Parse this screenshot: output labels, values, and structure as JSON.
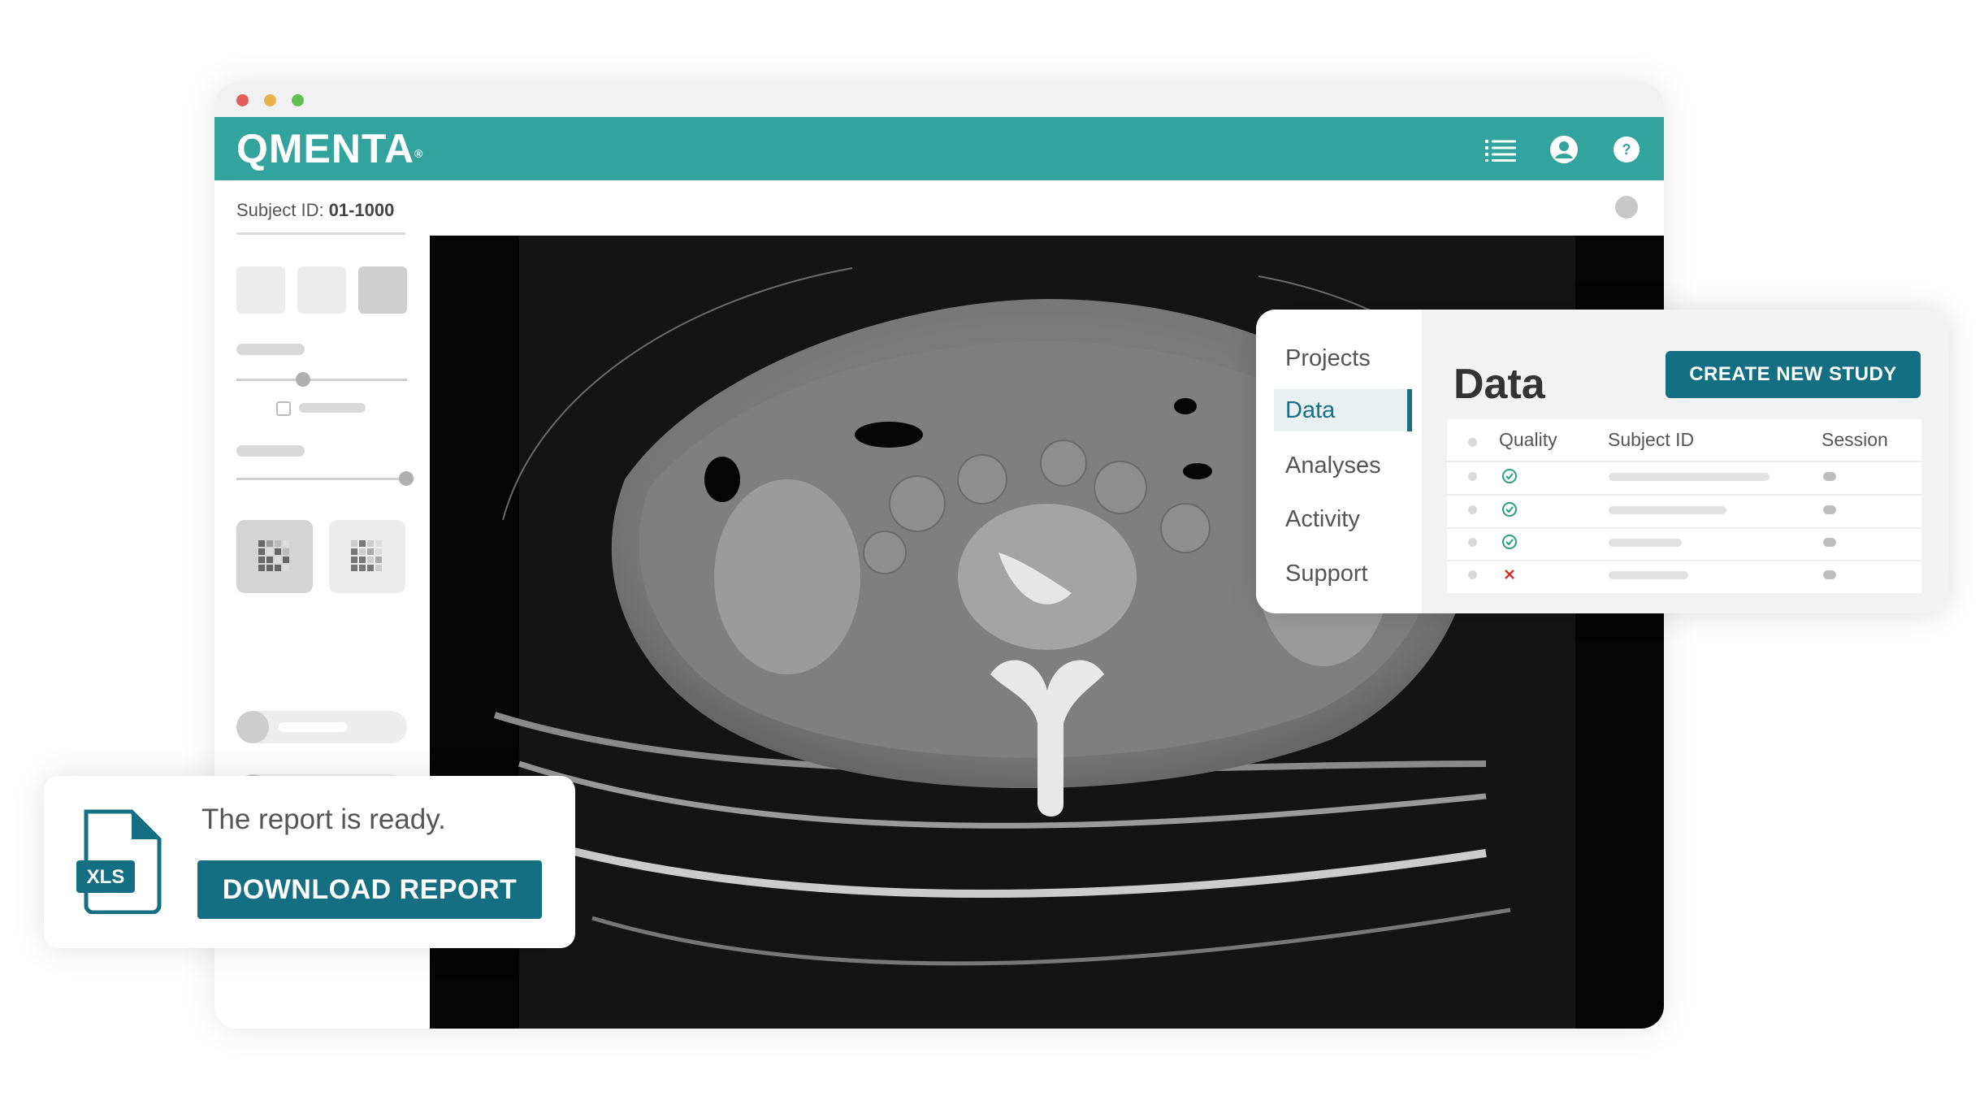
{
  "app": {
    "brand": "QMENTA",
    "brand_mark": "®",
    "accent_color": "#33a39e",
    "button_color": "#146f82",
    "icons": [
      "list-icon",
      "user-account-icon",
      "help-icon"
    ]
  },
  "subject": {
    "label": "Subject ID:",
    "value": "01-1000"
  },
  "data_panel": {
    "nav": [
      {
        "label": "Projects"
      },
      {
        "label": "Data"
      },
      {
        "label": "Analyses"
      },
      {
        "label": "Activity"
      },
      {
        "label": "Support"
      }
    ],
    "active_nav": "Data",
    "title": "Data",
    "create_button": "CREATE NEW STUDY",
    "columns": {
      "quality": "Quality",
      "subject_id": "Subject ID",
      "session": "Session"
    },
    "rows": [
      {
        "quality": "pass"
      },
      {
        "quality": "pass"
      },
      {
        "quality": "pass"
      },
      {
        "quality": "fail"
      }
    ]
  },
  "report": {
    "message": "The report is ready.",
    "download_button": "DOWNLOAD REPORT",
    "file_type": "XLS"
  }
}
